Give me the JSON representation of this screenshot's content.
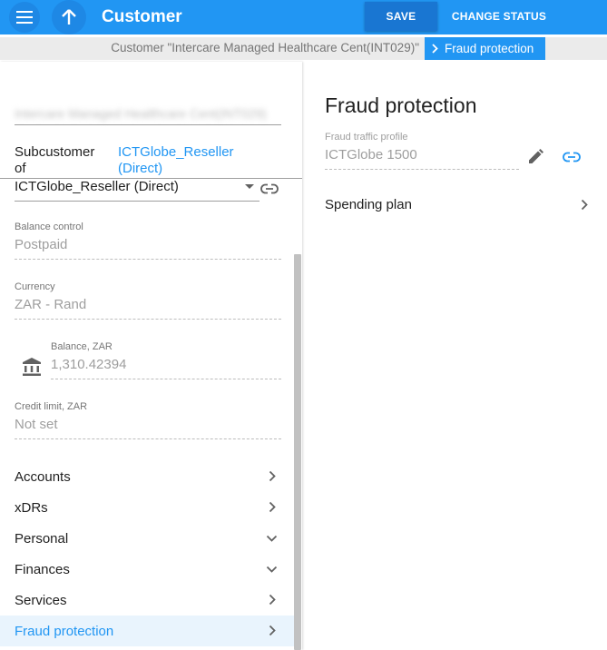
{
  "header": {
    "title": "Customer",
    "save_label": "SAVE",
    "change_status_label": "CHANGE STATUS"
  },
  "breadcrumb": {
    "customer": "Customer \"Intercare Managed Healthcare Cent(INT029)\"",
    "current": "Fraud protection"
  },
  "left": {
    "customer_name_blurred": "Intercare Managed Healthcare Cent(INT029)",
    "subcustomer_label": "Subcustomer of",
    "subcustomer_link": "ICTGlobe_Reseller (Direct)",
    "subcustomer_select": "ICTGlobe_Reseller (Direct)",
    "fields": {
      "balance_control": {
        "label": "Balance control",
        "value": "Postpaid"
      },
      "currency": {
        "label": "Currency",
        "value": "ZAR - Rand"
      },
      "balance": {
        "label": "Balance, ZAR",
        "value": "1,310.42394"
      },
      "credit_limit": {
        "label": "Credit limit, ZAR",
        "value": "Not set"
      }
    },
    "nav": [
      {
        "label": "Accounts",
        "icon": "chevron-right-icon"
      },
      {
        "label": "xDRs",
        "icon": "chevron-right-icon"
      },
      {
        "label": "Personal",
        "icon": "chevron-down-icon"
      },
      {
        "label": "Finances",
        "icon": "chevron-down-icon"
      },
      {
        "label": "Services",
        "icon": "chevron-right-icon"
      },
      {
        "label": "Fraud protection",
        "icon": "chevron-right-icon",
        "active": true
      }
    ]
  },
  "right": {
    "title": "Fraud protection",
    "fraud_profile": {
      "label": "Fraud traffic profile",
      "value": "ICTGlobe 1500"
    },
    "spending_plan": "Spending plan"
  },
  "colors": {
    "primary": "#2196f3",
    "primary_dark": "#1976d2",
    "active_row_bg": "#e9f4fd"
  }
}
